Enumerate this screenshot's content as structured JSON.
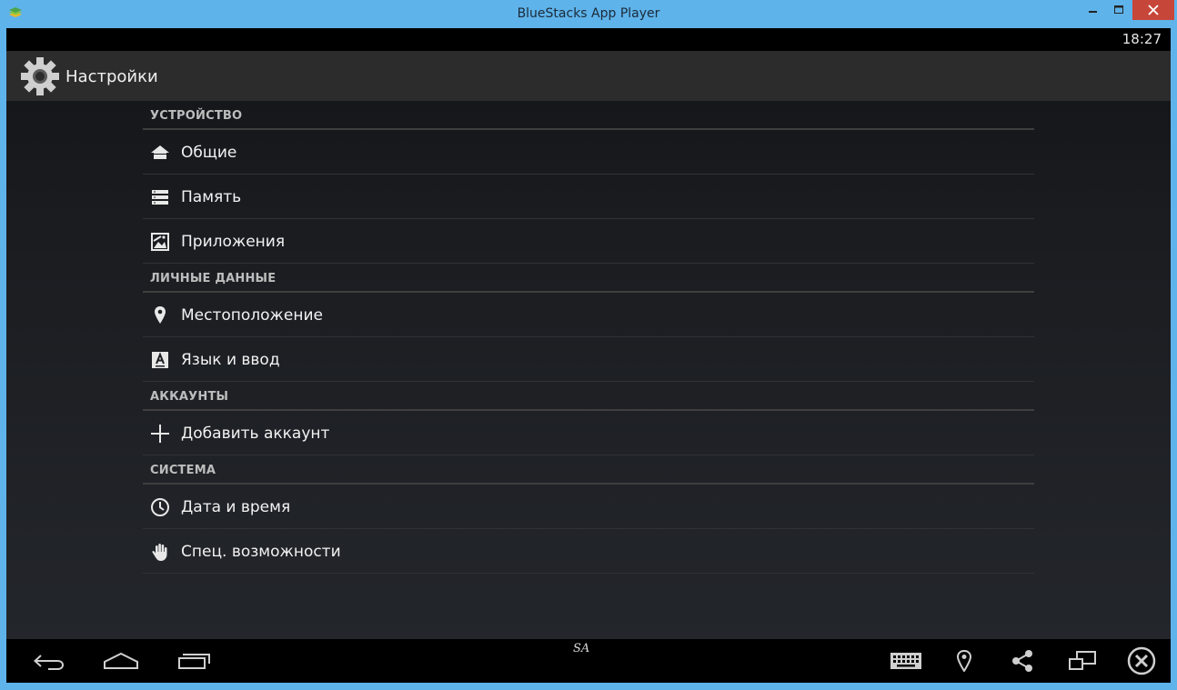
{
  "window": {
    "title": "BlueStacks App Player",
    "logo_icon": "bluestacks-logo-icon",
    "controls": [
      "minimize-icon",
      "maximize-icon",
      "close-icon"
    ]
  },
  "status_bar": {
    "time": "18:27"
  },
  "action_bar": {
    "icon": "gear-icon",
    "title": "Настройки"
  },
  "sections": [
    {
      "header": "УСТРОЙСТВО",
      "items": [
        {
          "label": "Общие",
          "icon": "home-icon"
        },
        {
          "label": "Память",
          "icon": "storage-icon"
        },
        {
          "label": "Приложения",
          "icon": "apps-icon"
        }
      ]
    },
    {
      "header": "ЛИЧНЫЕ ДАННЫЕ",
      "items": [
        {
          "label": "Местоположение",
          "icon": "location-icon"
        },
        {
          "label": "Язык и ввод",
          "icon": "language-icon"
        }
      ]
    },
    {
      "header": "АККАУНТЫ",
      "items": [
        {
          "label": "Добавить аккаунт",
          "icon": "plus-icon"
        }
      ]
    },
    {
      "header": "СИСТЕМА",
      "items": [
        {
          "label": "Дата и время",
          "icon": "clock-icon"
        },
        {
          "label": "Спец. возможности",
          "icon": "hand-icon"
        }
      ]
    }
  ],
  "nav_bar": {
    "left": [
      "back-icon",
      "home-icon",
      "recent-apps-icon"
    ],
    "right": [
      "keyboard-icon",
      "location-icon",
      "share-icon",
      "multi-screen-icon",
      "close-circle-icon"
    ]
  },
  "watermark": "SA",
  "colors": {
    "frame": "#5eb3ea",
    "close_button": "#c7463a",
    "action_bar": "#2c2c2c",
    "section_text": "#bdbdbd"
  }
}
